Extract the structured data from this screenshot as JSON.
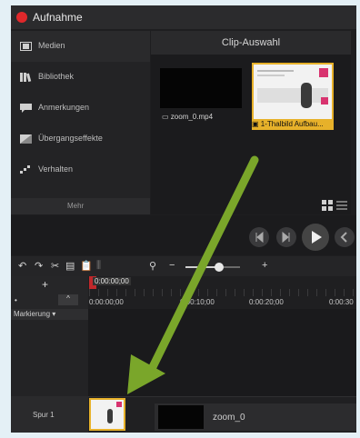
{
  "window": {
    "title": "Aufnahme"
  },
  "sidebar": {
    "items": [
      {
        "label": "Medien",
        "icon": "film-icon"
      },
      {
        "label": "Bibliothek",
        "icon": "library-icon"
      },
      {
        "label": "Anmerkungen",
        "icon": "annotation-icon"
      },
      {
        "label": "Übergangseffekte",
        "icon": "transition-icon"
      },
      {
        "label": "Verhalten",
        "icon": "behavior-icon"
      }
    ],
    "more_label": "Mehr"
  },
  "clip_bin": {
    "title": "Clip-Auswahl",
    "clips": [
      {
        "label": "zoom_0.mp4"
      },
      {
        "label": "1-Thalbild Aufbau..."
      }
    ]
  },
  "timeline": {
    "playhead_time": "0:00:00;00",
    "time_labels": [
      "0:00:00;00",
      "0:00:10;00",
      "0:00:20;00",
      "0:00:30"
    ],
    "marker_label": "Markierung",
    "track_label": "Spur 1",
    "clip_label": "zoom_0"
  },
  "colors": {
    "accent": "#e7b12a",
    "arrow": "#7aa62a",
    "record": "#e0282b"
  }
}
